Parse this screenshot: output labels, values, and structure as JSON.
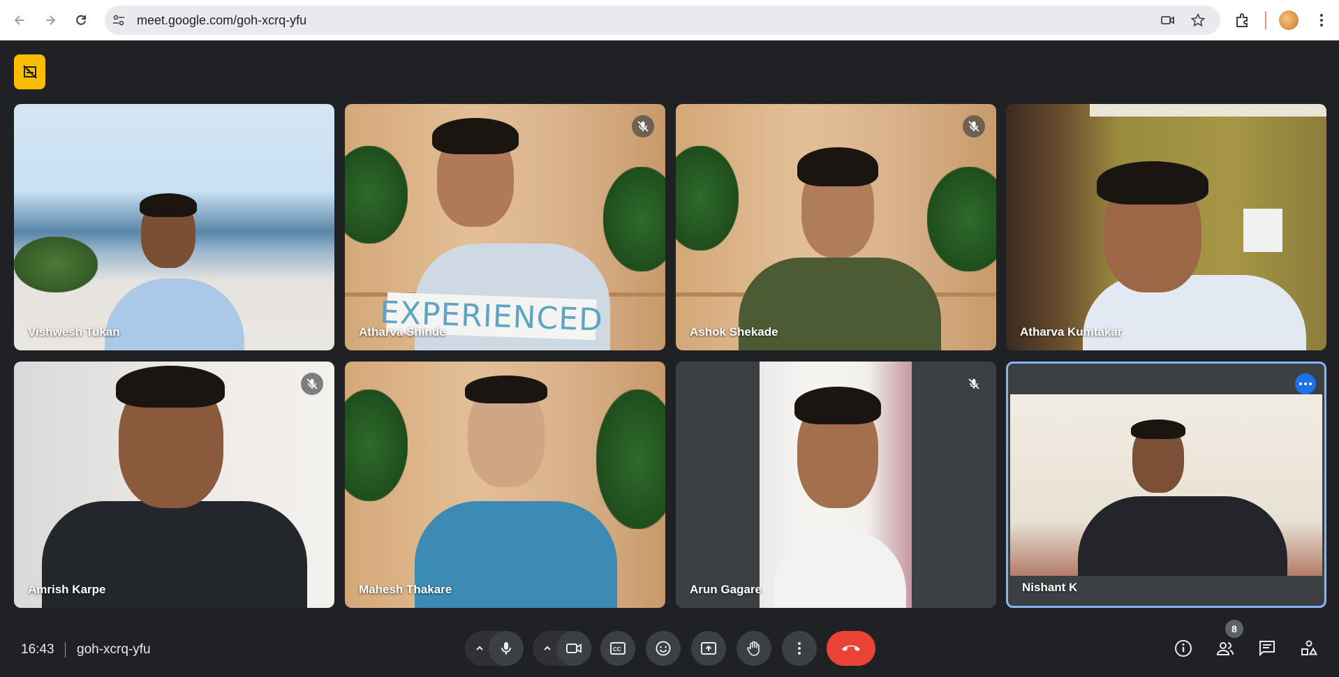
{
  "browser": {
    "url": "meet.google.com/goh-xcrq-yfu",
    "back_icon": "arrow-left-icon",
    "forward_icon": "arrow-right-icon",
    "reload_icon": "reload-icon"
  },
  "meeting": {
    "time": "16:43",
    "code": "goh-xcrq-yfu",
    "participant_count": "8"
  },
  "participants": [
    {
      "name": "Vishwesh Tukan",
      "muted": false
    },
    {
      "name": "Atharva Shinde",
      "muted": true,
      "sign_text": "EXPERIENCED"
    },
    {
      "name": "Ashok Shekade",
      "muted": true
    },
    {
      "name": "Atharva Kumtakar",
      "muted": false
    },
    {
      "name": "Amrish Karpe",
      "muted": true
    },
    {
      "name": "Mahesh Thakare",
      "muted": false
    },
    {
      "name": "Arun Gagare",
      "muted": true
    },
    {
      "name": "Nishant K",
      "muted": false,
      "active_speaker": true
    }
  ],
  "colors": {
    "background": "#202124",
    "tile": "#3c4043",
    "end_call": "#ea4335",
    "accent_yellow": "#fbbc04",
    "active_border": "#8ab4f8"
  }
}
